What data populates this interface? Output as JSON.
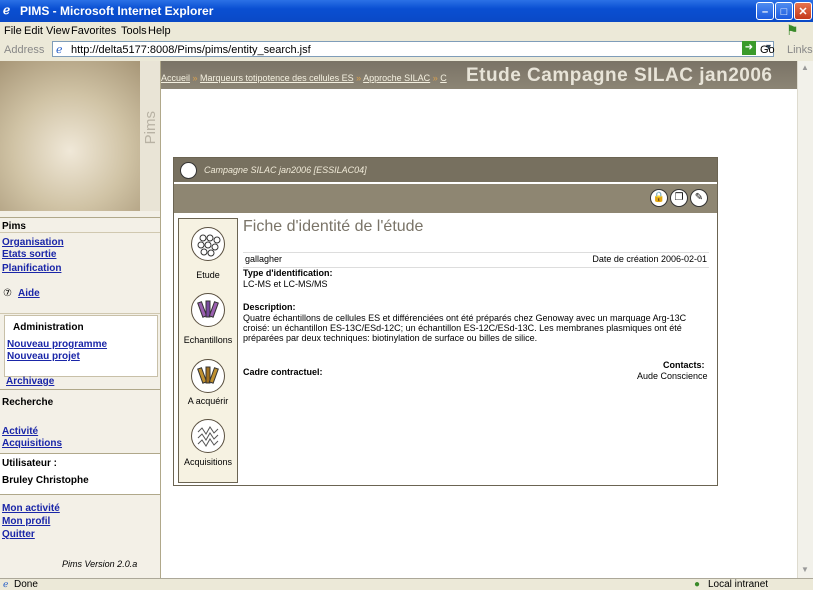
{
  "window": {
    "title": "PIMS - Microsoft Internet Explorer"
  },
  "menu": [
    "File",
    "Edit",
    "View",
    "Favorites",
    "Tools",
    "Help"
  ],
  "address": {
    "label": "Address",
    "url": "http://delta5177:8008/Pims/pims/entity_search.jsf",
    "go": "Go",
    "links": "Links"
  },
  "breadcrumb": {
    "items": [
      "Accueil",
      "Marqueurs totipotence des cellules ES",
      "Approche SILAC",
      "C"
    ],
    "page_title": "Etude Campagne SILAC jan2006"
  },
  "sidebar": {
    "brand": "Pims",
    "section_pims": "Pims",
    "links_pims": [
      "Organisation",
      "Etats sortie",
      "Planification"
    ],
    "aide": "Aide",
    "section_admin": "Administration",
    "links_admin": [
      "Nouveau programme",
      "Nouveau projet"
    ],
    "archivage": "Archivage",
    "section_recherche": "Recherche",
    "links_recherche": [
      "Activité",
      "Acquisitions"
    ],
    "section_user": "Utilisateur :",
    "user_name": "Bruley Christophe",
    "links_user": [
      "Mon activité",
      "Mon profil",
      "Quitter"
    ],
    "version": "Pims Version 2.0.a"
  },
  "card": {
    "header": "Campagne SILAC jan2006  [ESSILAC04]",
    "side_items": [
      "Etude",
      "Echantillons",
      "A acquérir",
      "Acquisitions"
    ],
    "title": "Fiche d'identité de l'étude",
    "owner": "gallagher",
    "creation_date": "Date de création 2006-02-01",
    "identification_label": "Type d'identification:",
    "identification_value": "LC-MS et LC-MS/MS",
    "description_label": "Description:",
    "description_value": "Quatre échantillons de cellules ES et différenciées ont été préparés chez Genoway avec un marquage Arg-13C croisé: un échantillon ES-13C/ESd-12C; un échantillon ES-12C/ESd-13C. Les membranes plasmiques ont été préparées par deux techniques: biotinylation de surface ou billes de silice.",
    "contract_label": "Cadre contractuel:",
    "contacts_label": "Contacts:",
    "contacts_value": "Aude Conscience"
  },
  "status": {
    "left": "Done",
    "right": "Local intranet"
  }
}
